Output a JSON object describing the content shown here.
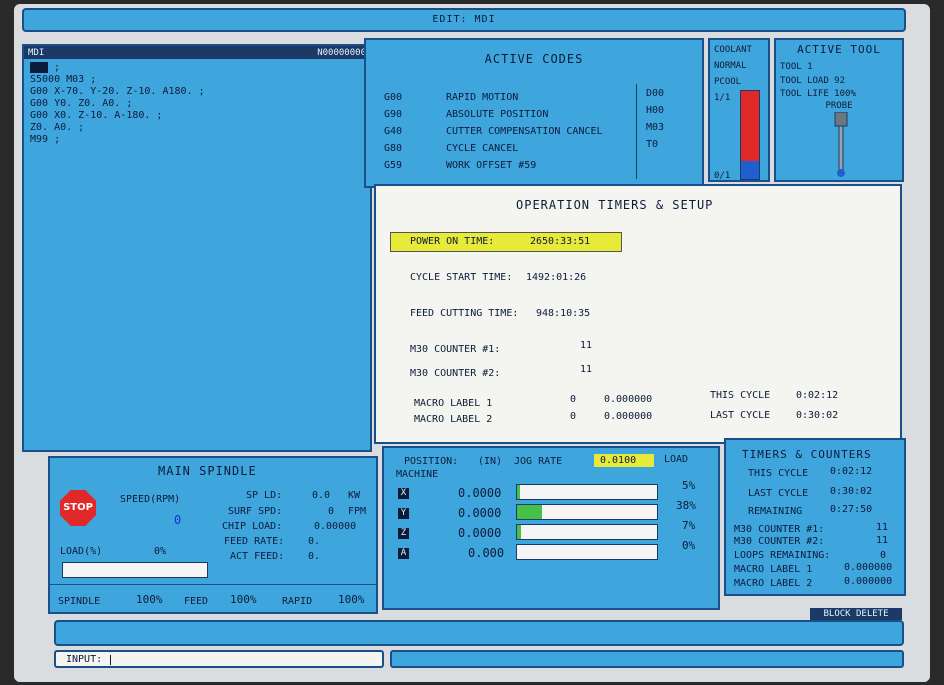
{
  "header": {
    "title": "EDIT: MDI"
  },
  "program": {
    "name": "MDI",
    "number": "N00000000",
    "lines": [
      ";",
      "S5000 M03 ;",
      "G00 X-70. Y-20. Z-10. A180. ;",
      "G00 Y0. Z0. A0. ;",
      "G00 X0. Z-10. A-180. ;",
      "Z0. A0. ;",
      "M99 ;"
    ]
  },
  "active_codes": {
    "title": "ACTIVE CODES",
    "rows": [
      {
        "code": "G00",
        "desc": "RAPID MOTION",
        "dcode": "D00"
      },
      {
        "code": "G90",
        "desc": "ABSOLUTE POSITION",
        "dcode": "H00"
      },
      {
        "code": "G40",
        "desc": "CUTTER COMPENSATION CANCEL",
        "dcode": "M03"
      },
      {
        "code": "G80",
        "desc": "CYCLE CANCEL",
        "dcode": "T0"
      },
      {
        "code": "G59",
        "desc": "WORK OFFSET #59",
        "dcode": ""
      }
    ]
  },
  "coolant": {
    "title": "COOLANT",
    "mode": "NORMAL",
    "pcool": "PCOOL",
    "top": "1/1",
    "bottom": "0/1",
    "level_fraction": 0.2
  },
  "active_tool": {
    "title": "ACTIVE TOOL",
    "tool": "TOOL 1",
    "load": "TOOL LOAD 92",
    "life": "TOOL LIFE 100%",
    "probe": "PROBE"
  },
  "timers": {
    "title": "OPERATION TIMERS & SETUP",
    "power_on_label": "POWER ON TIME:",
    "power_on_value": "2650:33:51",
    "cycle_start_label": "CYCLE START TIME:",
    "cycle_start_value": "1492:01:26",
    "feed_cut_label": "FEED CUTTING TIME:",
    "feed_cut_value": "948:10:35",
    "m30_1_label": "M30 COUNTER #1:",
    "m30_1_value": "11",
    "m30_2_label": "M30 COUNTER #2:",
    "m30_2_value": "11",
    "macro1_label": "MACRO LABEL 1",
    "macro1_idx": "0",
    "macro1_value": "0.000000",
    "macro2_label": "MACRO LABEL 2",
    "macro2_idx": "0",
    "macro2_value": "0.000000",
    "this_cycle_label": "THIS CYCLE",
    "this_cycle_value": "0:02:12",
    "last_cycle_label": "LAST CYCLE",
    "last_cycle_value": "0:30:02"
  },
  "spindle": {
    "title": "MAIN SPINDLE",
    "stop": "STOP",
    "speed_label": "SPEED(RPM)",
    "speed_value": "0",
    "load_label": "LOAD(%)",
    "load_value": "0%",
    "sp_ld_label": "SP LD:",
    "sp_ld_value": "0.0",
    "sp_ld_unit": "KW",
    "surf_label": "SURF SPD:",
    "surf_value": "0",
    "surf_unit": "FPM",
    "chip_label": "CHIP LOAD:",
    "chip_value": "0.00000",
    "feed_rate_label": "FEED RATE:",
    "feed_rate_value": "0.",
    "act_feed_label": "ACT FEED:",
    "act_feed_value": "0.",
    "spindle_label": "SPINDLE",
    "spindle_ov": "100%",
    "feed_label": "FEED",
    "feed_ov": "100%",
    "rapid_label": "RAPID",
    "rapid_ov": "100%"
  },
  "position": {
    "label": "POSITION:",
    "units": "(IN)",
    "jog_label": "JOG RATE",
    "jog_value": "0.0100",
    "load_label": "LOAD",
    "machine": "MACHINE",
    "axes": [
      {
        "axis": "X",
        "value": "0.0000",
        "load": "5%",
        "frac": 0.02
      },
      {
        "axis": "Y",
        "value": "0.0000",
        "load": "38%",
        "frac": 0.18
      },
      {
        "axis": "Z",
        "value": "0.0000",
        "load": "7%",
        "frac": 0.03
      },
      {
        "axis": "A",
        "value": "0.000",
        "load": "0%",
        "frac": 0.0
      }
    ]
  },
  "counters": {
    "title": "TIMERS & COUNTERS",
    "this_cycle_label": "THIS CYCLE",
    "this_cycle_value": "0:02:12",
    "last_cycle_label": "LAST CYCLE",
    "last_cycle_value": "0:30:02",
    "remaining_label": "REMAINING",
    "remaining_value": "0:27:50",
    "m30_1_label": "M30 COUNTER #1:",
    "m30_1_value": "11",
    "m30_2_label": "M30 COUNTER #2:",
    "m30_2_value": "11",
    "loops_label": "LOOPS REMAINING:",
    "loops_value": "0",
    "macro1_label": "MACRO LABEL 1",
    "macro1_value": "0.000000",
    "macro2_label": "MACRO LABEL 2",
    "macro2_value": "0.000000"
  },
  "status": {
    "block_delete": "BLOCK DELETE"
  },
  "input": {
    "label": "INPUT:",
    "value": ""
  },
  "colors": {
    "panel_blue": "#3fa6dd",
    "border": "#1b4f8a",
    "highlight": "#e8ea3a",
    "coolant_red": "#e02828",
    "coolant_blue": "#1f5fd0"
  }
}
